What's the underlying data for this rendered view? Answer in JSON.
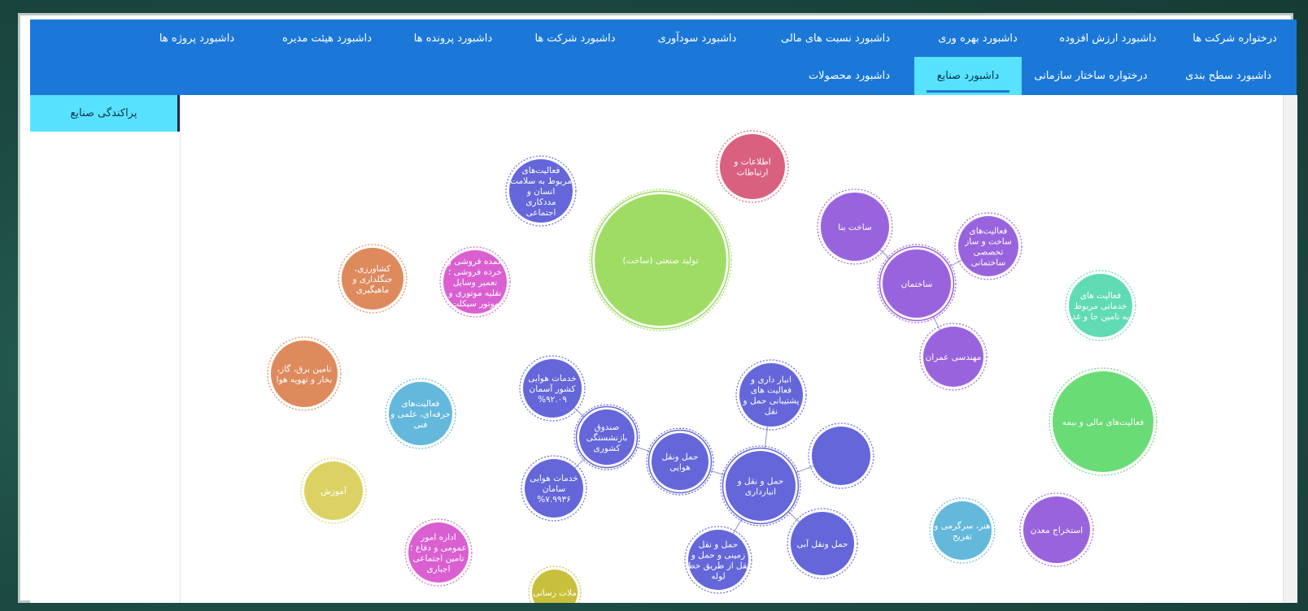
{
  "nav": {
    "row1": [
      "درختواره شرکت ها",
      "داشبورد ارزش افزوده",
      "داشبورد بهره وری",
      "داشبورد نسبت های مالی",
      "داشبورد سودآوری",
      "داشبورد شرکت ها",
      "داشبورد پرونده ها",
      "داشبورد هیئت مدیره",
      "داشبورد پروژه ها"
    ],
    "row2": [
      "داشبورد سطح بندی",
      "درختواره ساختار سازمانی",
      "داشبورد صنایع",
      "داشبورد محصولات"
    ],
    "active": "داشبورد صنایع"
  },
  "sidebar": {
    "tab_label": "پراکندگی صنایع"
  },
  "colors": {
    "nav_bg": "#1b78d9",
    "active_tab": "#57e3ff"
  },
  "bubbles": [
    {
      "id": "info",
      "lines": [
        "اطلاعات و",
        "ارتباطات"
      ],
      "color": "#d9607f"
    },
    {
      "id": "health",
      "lines": [
        "فعالیت‌های",
        "مربوط به سلامت",
        "انسان و",
        "مددکاری",
        "اجتماعی"
      ],
      "color": "#6466d9"
    },
    {
      "id": "manufacturing",
      "lines": [
        "(تولید صنعتی (ساخت"
      ],
      "color": "#9fdc64"
    },
    {
      "id": "building",
      "lines": [
        "ساخت بنا"
      ],
      "color": "#9a63de"
    },
    {
      "id": "special",
      "lines": [
        "فعالیت‌های",
        "ساخت و ساز",
        "تخصصی",
        "ساختمانی"
      ],
      "color": "#9a63de"
    },
    {
      "id": "construction",
      "lines": [
        "ساختمان"
      ],
      "color": "#9a63de"
    },
    {
      "id": "civil",
      "lines": [
        "مهندسی عمران"
      ],
      "color": "#9a63de"
    },
    {
      "id": "support",
      "lines": [
        "فعالیت های",
        "خدماتی مربوط",
        "به تامین جا و غذ"
      ],
      "color": "#60dbb5"
    },
    {
      "id": "finance",
      "lines": [
        "فعالیت‌های مالی و بیمه"
      ],
      "color": "#69dc76"
    },
    {
      "id": "agri",
      "lines": [
        "،کشاورزی",
        "جنگلداری و",
        "ماهیگیری"
      ],
      "color": "#de8a5c"
    },
    {
      "id": "wholesale",
      "lines": [
        "عمده فروشی و",
        "خرده فروشی ؛",
        "تعمیر وسایل",
        "نقلیه موتوری و",
        "موتور سیکلت"
      ],
      "color": "#da5fd1"
    },
    {
      "id": "electricity",
      "lines": [
        "،تامین برق، گاز",
        "بخار و تهویه هوا"
      ],
      "color": "#de8a5c"
    },
    {
      "id": "professional",
      "lines": [
        "فعالیت‌های",
        "حرفه‌ای، علمی و",
        "فنی"
      ],
      "color": "#64b8dc"
    },
    {
      "id": "education",
      "lines": [
        "آموزش"
      ],
      "color": "#dcd264"
    },
    {
      "id": "public",
      "lines": [
        "اداره امور",
        "عمومی و دفاع ؛",
        "تامین اجتماعی",
        "اجباری"
      ],
      "color": "#da5fd1"
    },
    {
      "id": "aseman",
      "lines": [
        "خدمات هوایی",
        "کشور آسمان",
        "%۹۲.۰۹"
      ],
      "color": "#6466d9"
    },
    {
      "id": "fund",
      "lines": [
        "صندوق",
        "بازنشستگی",
        "کشوری"
      ],
      "color": "#6466d9"
    },
    {
      "id": "saman",
      "lines": [
        "خدمات هوایی",
        "سامان",
        "%۷.۹۹۳۶"
      ],
      "color": "#6466d9"
    },
    {
      "id": "air",
      "lines": [
        "حمل ونقل",
        "هوایی"
      ],
      "color": "#6466d9"
    },
    {
      "id": "storage",
      "lines": [
        "انبار داری و",
        "فعالیت های",
        "پشتیبانی حمل و",
        "نقل"
      ],
      "color": "#6466d9"
    },
    {
      "id": "blank",
      "lines": [],
      "color": "#6466d9"
    },
    {
      "id": "transport",
      "lines": [
        "حمل و نقل و",
        "انبارداری"
      ],
      "color": "#6466d9"
    },
    {
      "id": "water",
      "lines": [
        "حمل ونقل آبی"
      ],
      "color": "#6466d9"
    },
    {
      "id": "land",
      "lines": [
        "حمل و نقل",
        "زمینی و حمل و",
        "نقل از طریق خط",
        "لوله"
      ],
      "color": "#6466d9"
    },
    {
      "id": "art",
      "lines": [
        "هنر، سرگرمی و",
        "تفریح"
      ],
      "color": "#64b8dc"
    },
    {
      "id": "mining",
      "lines": [
        "استخراج معدن"
      ],
      "color": "#9a63de"
    },
    {
      "id": "bottom",
      "lines": [
        "ملات رسانی"
      ],
      "color": "#c8c03a"
    }
  ]
}
